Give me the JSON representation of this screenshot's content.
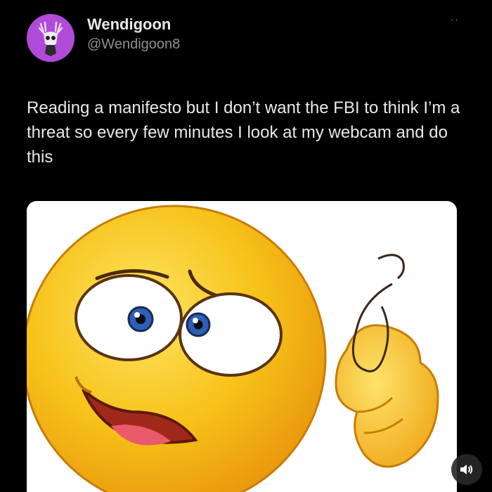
{
  "post": {
    "display_name": "Wendigoon",
    "handle": "@Wendigoon8",
    "more_icon": "more-dots-icon",
    "text": "Reading a manifesto but I don’t want the FBI to think I’m a threat so every few minutes I look at my webcam and do this"
  },
  "media": {
    "description_icon": "crazy-emoji-image",
    "sound_icon": "speaker-icon"
  },
  "colors": {
    "background": "#000000",
    "avatar": "#b04bd9",
    "emoji_yellow": "#f7c21a",
    "handle_gray": "#8b8f94"
  }
}
